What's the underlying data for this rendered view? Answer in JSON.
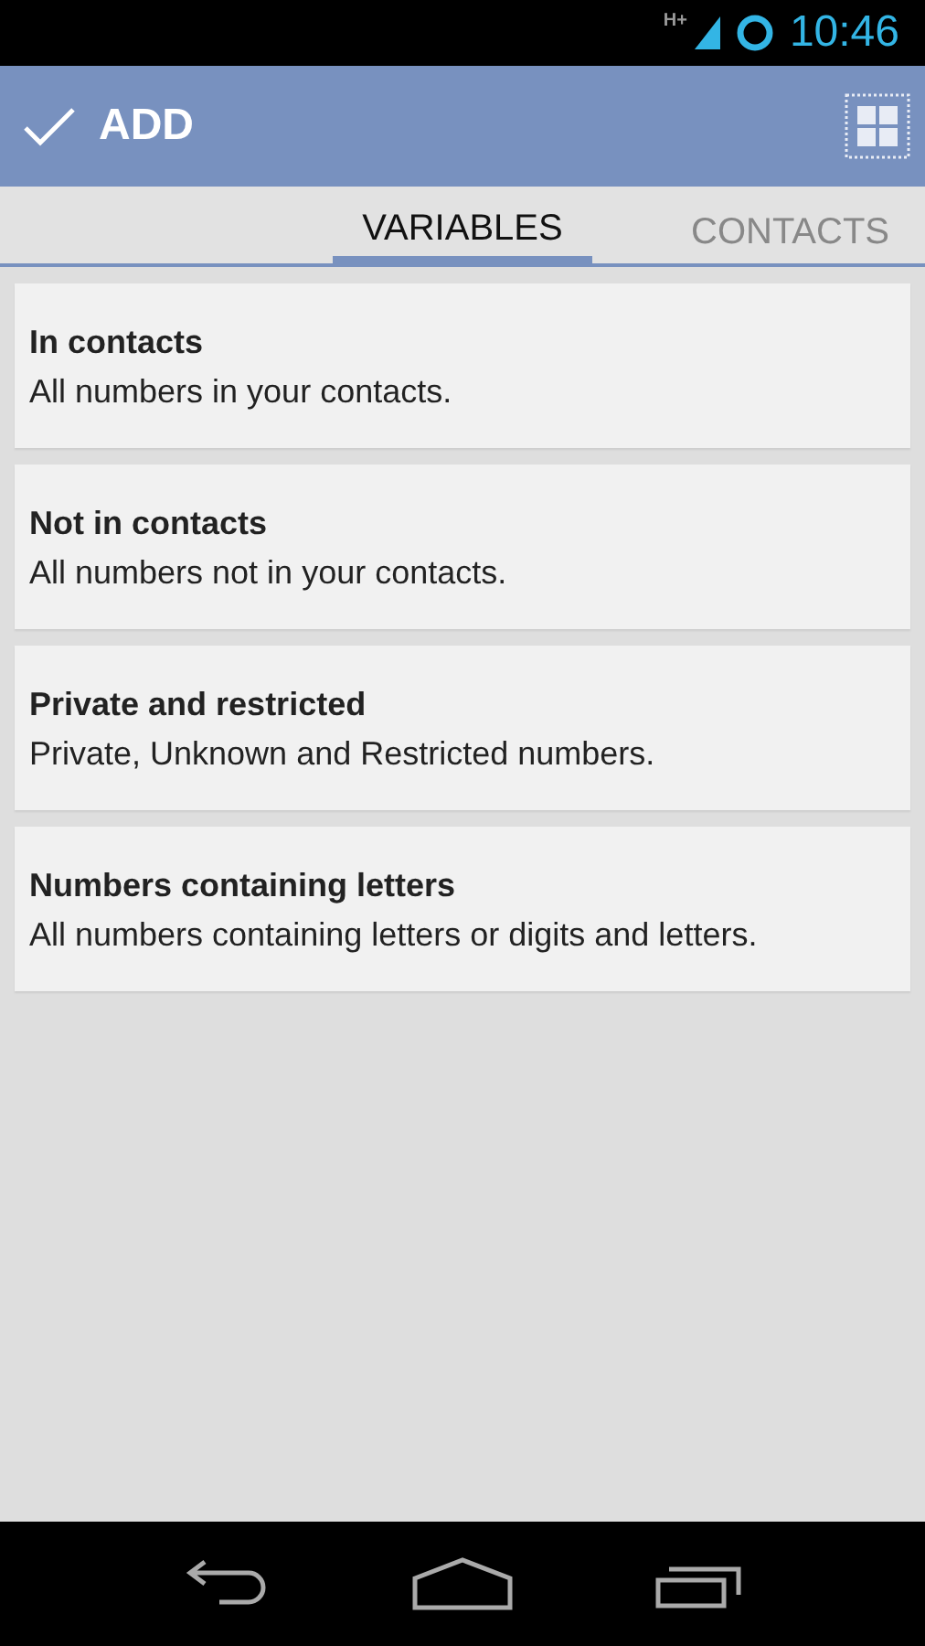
{
  "status_bar": {
    "network": "H+",
    "time": "10:46"
  },
  "action_bar": {
    "title": "ADD"
  },
  "tabs": [
    {
      "label": "VARIABLES",
      "selected": true
    },
    {
      "label": "CONTACTS",
      "selected": false
    }
  ],
  "items": [
    {
      "title": "In contacts",
      "description": "All numbers in your contacts."
    },
    {
      "title": "Not in contacts",
      "description": "All numbers not in your contacts."
    },
    {
      "title": "Private and restricted",
      "description": "Private, Unknown and Restricted numbers."
    },
    {
      "title": "Numbers containing letters",
      "description": "All numbers containing letters or digits and letters."
    }
  ]
}
